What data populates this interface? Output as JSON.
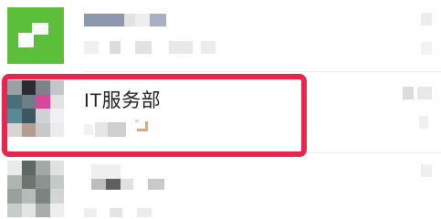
{
  "chat_list": {
    "items": [
      {
        "name": "",
        "preview": "",
        "time": "",
        "avatar": {
          "type": "green-logo",
          "color": "#5bbf3c"
        }
      },
      {
        "name": "IT服务部",
        "preview": "",
        "time": "",
        "avatar": {
          "type": "mosaic-photo"
        },
        "highlighted": true,
        "highlight_color": "#e6264d"
      },
      {
        "name": "",
        "preview": "",
        "time": "",
        "avatar": {
          "type": "mosaic-photo"
        }
      }
    ]
  }
}
